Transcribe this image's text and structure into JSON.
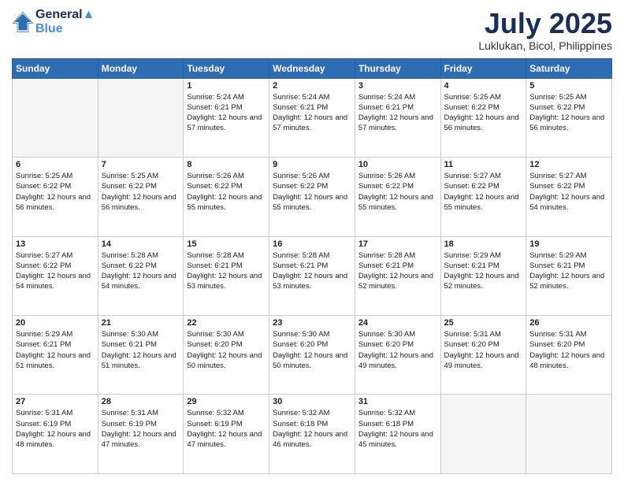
{
  "header": {
    "logo_line1": "General",
    "logo_line2": "Blue",
    "month_title": "July 2025",
    "location": "Luklukan, Bicol, Philippines"
  },
  "weekdays": [
    "Sunday",
    "Monday",
    "Tuesday",
    "Wednesday",
    "Thursday",
    "Friday",
    "Saturday"
  ],
  "weeks": [
    [
      {
        "day": "",
        "empty": true
      },
      {
        "day": "",
        "empty": true
      },
      {
        "day": "1",
        "sunrise": "Sunrise: 5:24 AM",
        "sunset": "Sunset: 6:21 PM",
        "daylight": "Daylight: 12 hours and 57 minutes."
      },
      {
        "day": "2",
        "sunrise": "Sunrise: 5:24 AM",
        "sunset": "Sunset: 6:21 PM",
        "daylight": "Daylight: 12 hours and 57 minutes."
      },
      {
        "day": "3",
        "sunrise": "Sunrise: 5:24 AM",
        "sunset": "Sunset: 6:21 PM",
        "daylight": "Daylight: 12 hours and 57 minutes."
      },
      {
        "day": "4",
        "sunrise": "Sunrise: 5:25 AM",
        "sunset": "Sunset: 6:22 PM",
        "daylight": "Daylight: 12 hours and 56 minutes."
      },
      {
        "day": "5",
        "sunrise": "Sunrise: 5:25 AM",
        "sunset": "Sunset: 6:22 PM",
        "daylight": "Daylight: 12 hours and 56 minutes."
      }
    ],
    [
      {
        "day": "6",
        "sunrise": "Sunrise: 5:25 AM",
        "sunset": "Sunset: 6:22 PM",
        "daylight": "Daylight: 12 hours and 56 minutes."
      },
      {
        "day": "7",
        "sunrise": "Sunrise: 5:25 AM",
        "sunset": "Sunset: 6:22 PM",
        "daylight": "Daylight: 12 hours and 56 minutes."
      },
      {
        "day": "8",
        "sunrise": "Sunrise: 5:26 AM",
        "sunset": "Sunset: 6:22 PM",
        "daylight": "Daylight: 12 hours and 55 minutes."
      },
      {
        "day": "9",
        "sunrise": "Sunrise: 5:26 AM",
        "sunset": "Sunset: 6:22 PM",
        "daylight": "Daylight: 12 hours and 55 minutes."
      },
      {
        "day": "10",
        "sunrise": "Sunrise: 5:26 AM",
        "sunset": "Sunset: 6:22 PM",
        "daylight": "Daylight: 12 hours and 55 minutes."
      },
      {
        "day": "11",
        "sunrise": "Sunrise: 5:27 AM",
        "sunset": "Sunset: 6:22 PM",
        "daylight": "Daylight: 12 hours and 55 minutes."
      },
      {
        "day": "12",
        "sunrise": "Sunrise: 5:27 AM",
        "sunset": "Sunset: 6:22 PM",
        "daylight": "Daylight: 12 hours and 54 minutes."
      }
    ],
    [
      {
        "day": "13",
        "sunrise": "Sunrise: 5:27 AM",
        "sunset": "Sunset: 6:22 PM",
        "daylight": "Daylight: 12 hours and 54 minutes."
      },
      {
        "day": "14",
        "sunrise": "Sunrise: 5:28 AM",
        "sunset": "Sunset: 6:22 PM",
        "daylight": "Daylight: 12 hours and 54 minutes."
      },
      {
        "day": "15",
        "sunrise": "Sunrise: 5:28 AM",
        "sunset": "Sunset: 6:21 PM",
        "daylight": "Daylight: 12 hours and 53 minutes."
      },
      {
        "day": "16",
        "sunrise": "Sunrise: 5:28 AM",
        "sunset": "Sunset: 6:21 PM",
        "daylight": "Daylight: 12 hours and 53 minutes."
      },
      {
        "day": "17",
        "sunrise": "Sunrise: 5:28 AM",
        "sunset": "Sunset: 6:21 PM",
        "daylight": "Daylight: 12 hours and 52 minutes."
      },
      {
        "day": "18",
        "sunrise": "Sunrise: 5:29 AM",
        "sunset": "Sunset: 6:21 PM",
        "daylight": "Daylight: 12 hours and 52 minutes."
      },
      {
        "day": "19",
        "sunrise": "Sunrise: 5:29 AM",
        "sunset": "Sunset: 6:21 PM",
        "daylight": "Daylight: 12 hours and 52 minutes."
      }
    ],
    [
      {
        "day": "20",
        "sunrise": "Sunrise: 5:29 AM",
        "sunset": "Sunset: 6:21 PM",
        "daylight": "Daylight: 12 hours and 51 minutes."
      },
      {
        "day": "21",
        "sunrise": "Sunrise: 5:30 AM",
        "sunset": "Sunset: 6:21 PM",
        "daylight": "Daylight: 12 hours and 51 minutes."
      },
      {
        "day": "22",
        "sunrise": "Sunrise: 5:30 AM",
        "sunset": "Sunset: 6:20 PM",
        "daylight": "Daylight: 12 hours and 50 minutes."
      },
      {
        "day": "23",
        "sunrise": "Sunrise: 5:30 AM",
        "sunset": "Sunset: 6:20 PM",
        "daylight": "Daylight: 12 hours and 50 minutes."
      },
      {
        "day": "24",
        "sunrise": "Sunrise: 5:30 AM",
        "sunset": "Sunset: 6:20 PM",
        "daylight": "Daylight: 12 hours and 49 minutes."
      },
      {
        "day": "25",
        "sunrise": "Sunrise: 5:31 AM",
        "sunset": "Sunset: 6:20 PM",
        "daylight": "Daylight: 12 hours and 49 minutes."
      },
      {
        "day": "26",
        "sunrise": "Sunrise: 5:31 AM",
        "sunset": "Sunset: 6:20 PM",
        "daylight": "Daylight: 12 hours and 48 minutes."
      }
    ],
    [
      {
        "day": "27",
        "sunrise": "Sunrise: 5:31 AM",
        "sunset": "Sunset: 6:19 PM",
        "daylight": "Daylight: 12 hours and 48 minutes."
      },
      {
        "day": "28",
        "sunrise": "Sunrise: 5:31 AM",
        "sunset": "Sunset: 6:19 PM",
        "daylight": "Daylight: 12 hours and 47 minutes."
      },
      {
        "day": "29",
        "sunrise": "Sunrise: 5:32 AM",
        "sunset": "Sunset: 6:19 PM",
        "daylight": "Daylight: 12 hours and 47 minutes."
      },
      {
        "day": "30",
        "sunrise": "Sunrise: 5:32 AM",
        "sunset": "Sunset: 6:18 PM",
        "daylight": "Daylight: 12 hours and 46 minutes."
      },
      {
        "day": "31",
        "sunrise": "Sunrise: 5:32 AM",
        "sunset": "Sunset: 6:18 PM",
        "daylight": "Daylight: 12 hours and 45 minutes."
      },
      {
        "day": "",
        "empty": true
      },
      {
        "day": "",
        "empty": true
      }
    ]
  ]
}
